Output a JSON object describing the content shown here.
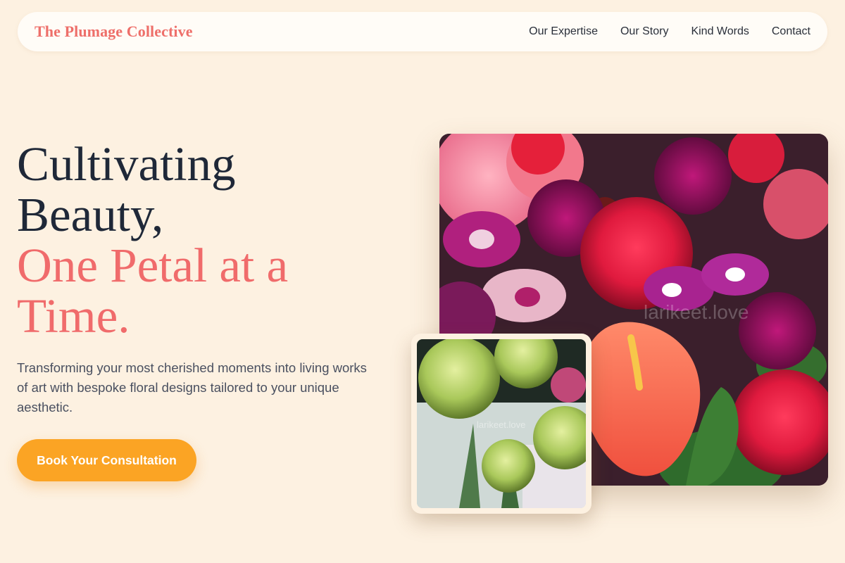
{
  "brand": {
    "name": "The Plumage Collective"
  },
  "nav": {
    "links": [
      {
        "label": "Our Expertise"
      },
      {
        "label": "Our Story"
      },
      {
        "label": "Kind Words"
      },
      {
        "label": "Contact"
      }
    ]
  },
  "hero": {
    "title_line1": "Cultivating",
    "title_line2": "Beauty,",
    "title_line3": "One Petal at a",
    "title_line4": "Time.",
    "subtitle": "Transforming your most cherished moments into living works of art with bespoke floral designs tailored to your unique aesthetic.",
    "cta_label": "Book Your Consultation"
  },
  "images": {
    "main_watermark": "larikeet.love",
    "inset_watermark": "larikeet.love"
  },
  "colors": {
    "background": "#fdf1e1",
    "brand": "#ee6f6a",
    "accent": "#f06b6b",
    "cta": "#fba424",
    "heading": "#1f2838"
  }
}
